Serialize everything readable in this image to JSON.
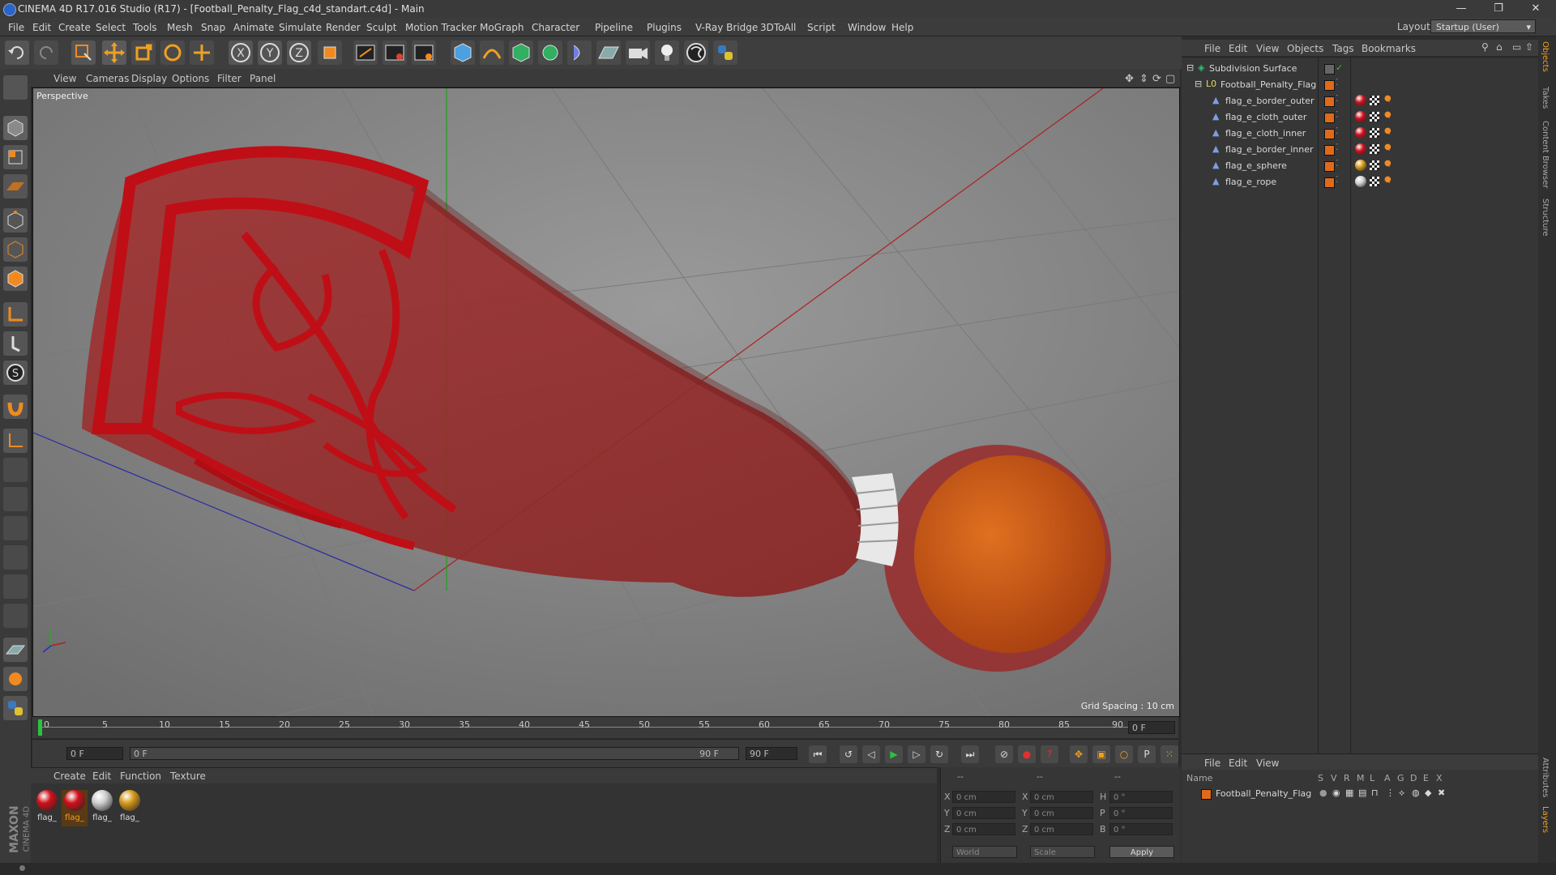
{
  "window": {
    "title": "CINEMA 4D R17.016 Studio (R17) - [Football_Penalty_Flag_c4d_standart.c4d] - Main",
    "min": "—",
    "max": "❐",
    "close": "✕"
  },
  "menubar": [
    "File",
    "Edit",
    "Create",
    "Select",
    "Tools",
    "Mesh",
    "Snap",
    "Animate",
    "Simulate",
    "Render",
    "Sculpt",
    "Motion Tracker",
    "MoGraph",
    "Character",
    "Pipeline",
    "Plugins",
    "V-Ray Bridge",
    "3DToAll",
    "Script",
    "Window",
    "Help"
  ],
  "layout": {
    "label": "Layout:",
    "value": "Startup (User)"
  },
  "viewport": {
    "menu": [
      "View",
      "Cameras",
      "Display",
      "Options",
      "Filter",
      "Panel"
    ],
    "label": "Perspective",
    "grid_spacing": "Grid Spacing : 10 cm"
  },
  "timeline": {
    "ticks": [
      "0",
      "5",
      "10",
      "15",
      "20",
      "25",
      "30",
      "35",
      "40",
      "45",
      "50",
      "55",
      "60",
      "65",
      "70",
      "75",
      "80",
      "85",
      "90"
    ],
    "current_frame": "0 F",
    "start": "0 F",
    "range_start": "0 F",
    "range_end": "90 F",
    "end": "90 F"
  },
  "materials": {
    "menu": [
      "Create",
      "Edit",
      "Function",
      "Texture"
    ],
    "items": [
      {
        "label": "flag_",
        "color": "#d0101a"
      },
      {
        "label": "flag_",
        "color": "#d0101a"
      },
      {
        "label": "flag_",
        "color": "#cfcfcf"
      },
      {
        "label": "flag_",
        "color": "#d79a1a"
      }
    ]
  },
  "coords": {
    "header": [
      "--",
      "--",
      "--"
    ],
    "rows": [
      {
        "a": "X",
        "av": "0 cm",
        "b": "X",
        "bv": "0 cm",
        "c": "H",
        "cv": "0 °"
      },
      {
        "a": "Y",
        "av": "0 cm",
        "b": "Y",
        "bv": "0 cm",
        "c": "P",
        "cv": "0 °"
      },
      {
        "a": "Z",
        "av": "0 cm",
        "b": "Z",
        "bv": "0 cm",
        "c": "B",
        "cv": "0 °"
      }
    ],
    "mode1": "World",
    "mode2": "Scale",
    "apply": "Apply"
  },
  "objects": {
    "menu": [
      "File",
      "Edit",
      "View",
      "Objects",
      "Tags",
      "Bookmarks"
    ],
    "tree": [
      {
        "name": "Subdivision Surface",
        "tag": "",
        "level": 0
      },
      {
        "name": "Football_Penalty_Flag",
        "tag": "",
        "level": 1
      },
      {
        "name": "flag_e_border_outer",
        "tag": "#d0101a",
        "level": 2
      },
      {
        "name": "flag_e_cloth_outer",
        "tag": "#d0101a",
        "level": 2
      },
      {
        "name": "flag_e_cloth_inner",
        "tag": "#d0101a",
        "level": 2
      },
      {
        "name": "flag_e_border_inner",
        "tag": "#d0101a",
        "level": 2
      },
      {
        "name": "flag_e_sphere",
        "tag": "#d79a1a",
        "level": 2
      },
      {
        "name": "flag_e_rope",
        "tag": "#cfcfcf",
        "level": 2
      }
    ]
  },
  "layers": {
    "menu": [
      "File",
      "Edit",
      "View"
    ],
    "columns": [
      "Name",
      "S",
      "V",
      "R",
      "M",
      "L",
      "A",
      "G",
      "D",
      "E",
      "X"
    ],
    "row": "Football_Penalty_Flag"
  },
  "side_tabs": [
    "Objects",
    "Takes",
    "Content Browser",
    "Structure",
    "Attributes",
    "Layers"
  ],
  "branding": {
    "maxon": "MAXON",
    "product": "CINEMA 4D"
  },
  "colors": {
    "cloth": "#9c2a2a",
    "border": "#c8101a",
    "sphere": "#d4641a",
    "accent": "#e06a1a"
  }
}
